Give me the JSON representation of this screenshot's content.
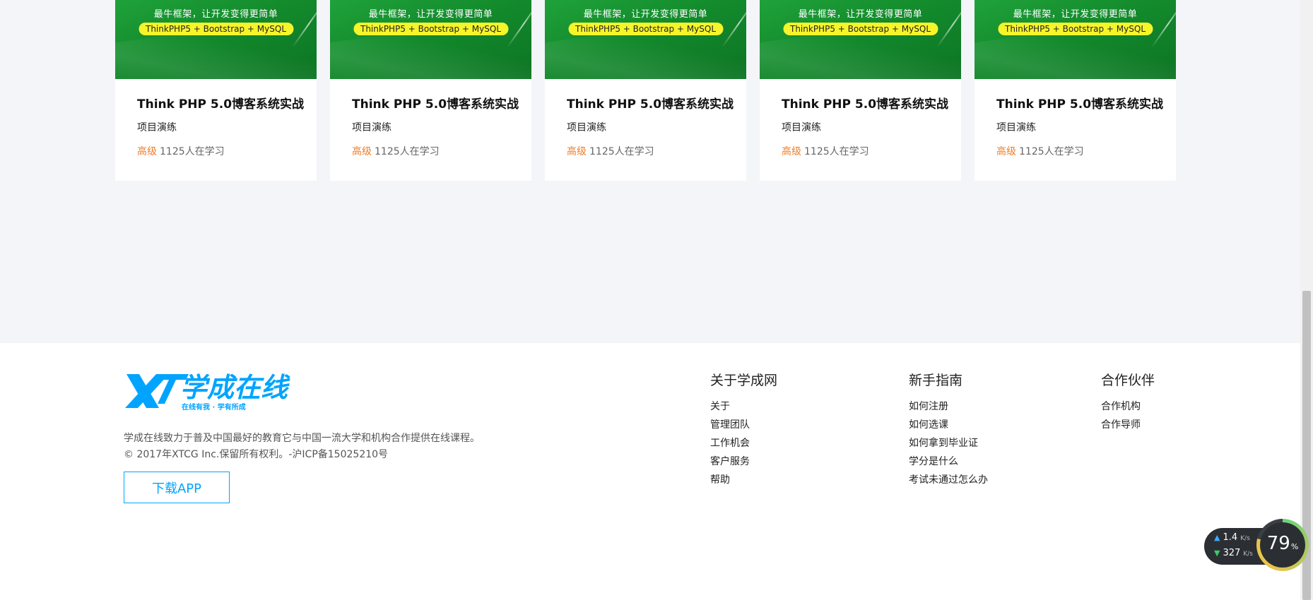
{
  "courses": [
    {
      "banner_slogan": "最牛框架，让开发变得更简单",
      "banner_tech": "ThinkPHP5 + Bootstrap + MySQL",
      "title": "Think PHP 5.0博客系统实战",
      "subtitle": "项目演练",
      "level": "高级",
      "learners": "1125人在学习"
    },
    {
      "banner_slogan": "最牛框架，让开发变得更简单",
      "banner_tech": "ThinkPHP5 + Bootstrap + MySQL",
      "title": "Think PHP 5.0博客系统实战",
      "subtitle": "项目演练",
      "level": "高级",
      "learners": "1125人在学习"
    },
    {
      "banner_slogan": "最牛框架，让开发变得更简单",
      "banner_tech": "ThinkPHP5 + Bootstrap + MySQL",
      "title": "Think PHP 5.0博客系统实战",
      "subtitle": "项目演练",
      "level": "高级",
      "learners": "1125人在学习"
    },
    {
      "banner_slogan": "最牛框架，让开发变得更简单",
      "banner_tech": "ThinkPHP5 + Bootstrap + MySQL",
      "title": "Think PHP 5.0博客系统实战",
      "subtitle": "项目演练",
      "level": "高级",
      "learners": "1125人在学习"
    },
    {
      "banner_slogan": "最牛框架，让开发变得更简单",
      "banner_tech": "ThinkPHP5 + Bootstrap + MySQL",
      "title": "Think PHP 5.0博客系统实战",
      "subtitle": "项目演练",
      "level": "高级",
      "learners": "1125人在学习"
    }
  ],
  "footer": {
    "logo_text": "学成在线",
    "logo_tagline": "在线有我 · 学有所成",
    "description": "学成在线致力于普及中国最好的教育它与中国一流大学和机构合作提供在线课程。",
    "copyright": "© 2017年XTCG Inc.保留所有权利。-沪ICP备15025210号",
    "download_label": "下载APP",
    "columns": [
      {
        "title": "关于学成网",
        "links": [
          "关于",
          "管理团队",
          "工作机会",
          "客户服务",
          "帮助"
        ]
      },
      {
        "title": "新手指南",
        "links": [
          "如何注册",
          "如何选课",
          "如何拿到毕业证",
          "学分是什么",
          "考试未通过怎么办"
        ]
      },
      {
        "title": "合作伙伴",
        "links": [
          "合作机构",
          "合作导师"
        ]
      }
    ]
  },
  "net_widget": {
    "upload_speed": "1.4",
    "upload_unit": "K/s",
    "download_speed": "327",
    "download_unit": "K/s",
    "gauge_value": "79",
    "gauge_unit": "%"
  },
  "colors": {
    "accent": "#00a4ff",
    "level": "#ef7d28",
    "banner_green": "#138a2c",
    "background": "#f3f5f9"
  }
}
